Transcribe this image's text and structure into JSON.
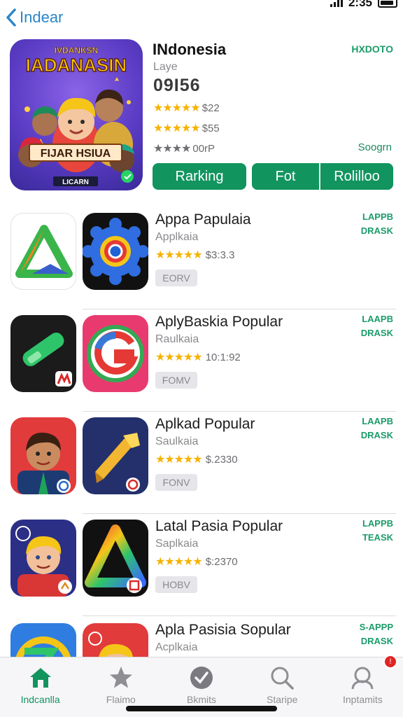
{
  "status": {
    "time": "2:35"
  },
  "nav": {
    "back_label": "Indear"
  },
  "featured": {
    "art_top_text": "IVDANKSN",
    "art_title": "IADANASIN",
    "art_banner": "FIJAR HSIUA",
    "art_small": "LICARN",
    "title": "INdonesia",
    "subtitle": "Laye",
    "number": "09I56",
    "ratings": [
      {
        "stars": "★★★★★",
        "value": "$22",
        "grey": false
      },
      {
        "stars": "★★★★★",
        "value": "$55",
        "grey": false
      },
      {
        "stars": "★★★★",
        "value": "00rP",
        "grey": true
      }
    ],
    "brand": "HXDOTO",
    "link": "Soogrn",
    "buttons": [
      "Rarking",
      "Fot",
      "Rolilloo"
    ]
  },
  "apps": [
    {
      "title": "Appa Papulaia",
      "sub": "Applkaia",
      "stars": "★★★★★",
      "price": "$3:3.3",
      "get": "EORV",
      "badge_lines": [
        "LAPPB",
        "DRASK"
      ]
    },
    {
      "title": "AplyBaskia Popular",
      "sub": "Raulkaia",
      "stars": "★★★★★",
      "price": "10:1:92",
      "get": "FOMV",
      "badge_lines": [
        "LAAPB",
        "DRASK"
      ]
    },
    {
      "title": "Aplkad Popular",
      "sub": "Saulkaia",
      "stars": "★★★★★",
      "price": "$.2330",
      "get": "FONV",
      "badge_lines": [
        "LAAPB",
        "DRASK"
      ]
    },
    {
      "title": "Latal Pasia Popular",
      "sub": "Saplkaia",
      "stars": "★★★★★",
      "price": "$:2370",
      "get": "HOBV",
      "badge_lines": [
        "LAPPB",
        "TEASK"
      ]
    },
    {
      "title": "Apla Pasisia Sopular",
      "sub": "Acplkaia",
      "stars": "",
      "price": "",
      "get": "",
      "badge_lines": [
        "S-APPP",
        "DRASK"
      ]
    }
  ],
  "tabs": [
    {
      "label": "Indcanlla",
      "icon": "home-icon",
      "active": true
    },
    {
      "label": "Flaimo",
      "icon": "star-icon",
      "active": false
    },
    {
      "label": "Bkmits",
      "icon": "check-circle-icon",
      "active": false
    },
    {
      "label": "Staripe",
      "icon": "search-icon",
      "active": false
    },
    {
      "label": "Inptamits",
      "icon": "profile-icon",
      "active": false,
      "badge": "!"
    }
  ],
  "colors": {
    "accent": "#12945f",
    "link": "#2a86c8",
    "star": "#f5b301",
    "badge": "#e02424"
  }
}
